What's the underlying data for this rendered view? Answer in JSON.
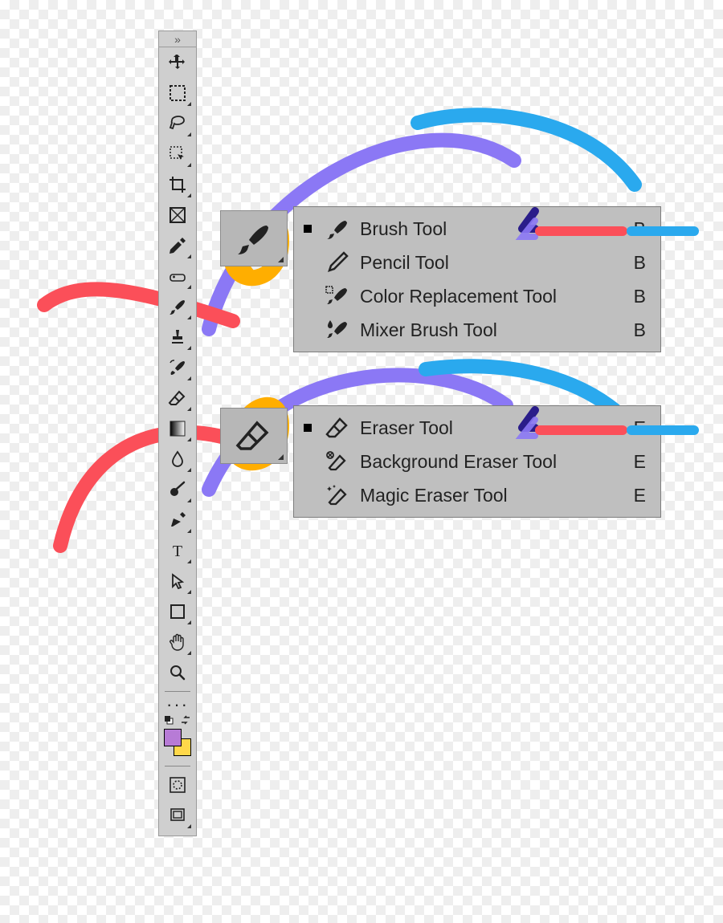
{
  "toolbar": {
    "collapse_glyph": "»",
    "tools": [
      {
        "id": "move",
        "has_sub": false
      },
      {
        "id": "marquee",
        "has_sub": true
      },
      {
        "id": "lasso",
        "has_sub": true
      },
      {
        "id": "quick-select",
        "has_sub": true
      },
      {
        "id": "crop",
        "has_sub": true
      },
      {
        "id": "frame",
        "has_sub": false
      },
      {
        "id": "eyedropper",
        "has_sub": true
      },
      {
        "id": "spot-heal",
        "has_sub": true
      },
      {
        "id": "brush",
        "has_sub": true
      },
      {
        "id": "stamp",
        "has_sub": true
      },
      {
        "id": "history-brush",
        "has_sub": true
      },
      {
        "id": "eraser",
        "has_sub": true
      },
      {
        "id": "gradient",
        "has_sub": true
      },
      {
        "id": "blur",
        "has_sub": true
      },
      {
        "id": "dodge",
        "has_sub": true
      },
      {
        "id": "pen",
        "has_sub": true
      },
      {
        "id": "type",
        "has_sub": true
      },
      {
        "id": "path-select",
        "has_sub": true
      },
      {
        "id": "shape",
        "has_sub": true
      },
      {
        "id": "hand",
        "has_sub": true
      },
      {
        "id": "zoom",
        "has_sub": false
      }
    ],
    "more_glyph": "···",
    "colors": {
      "foreground": "#b77bd6",
      "background": "#ffd84a"
    }
  },
  "callouts": {
    "brush_big_icon": "brush",
    "eraser_big_icon": "eraser"
  },
  "flyout_brush": {
    "items": [
      {
        "label": "Brush Tool",
        "shortcut": "B",
        "icon": "brush",
        "active": true
      },
      {
        "label": "Pencil Tool",
        "shortcut": "B",
        "icon": "pencil",
        "active": false
      },
      {
        "label": "Color Replacement Tool",
        "shortcut": "B",
        "icon": "color-replace",
        "active": false
      },
      {
        "label": "Mixer Brush Tool",
        "shortcut": "B",
        "icon": "mixer-brush",
        "active": false
      }
    ]
  },
  "flyout_eraser": {
    "items": [
      {
        "label": "Eraser Tool",
        "shortcut": "E",
        "icon": "eraser",
        "active": true
      },
      {
        "label": "Background Eraser Tool",
        "shortcut": "E",
        "icon": "bg-eraser",
        "active": false
      },
      {
        "label": "Magic Eraser Tool",
        "shortcut": "E",
        "icon": "magic-eraser",
        "active": false
      }
    ]
  },
  "annotation_colors": {
    "red": "#fb4f59",
    "orange": "#ffae00",
    "purple": "#8b78f5",
    "blue": "#2aa9ee",
    "navy": "#2a1d8a"
  }
}
